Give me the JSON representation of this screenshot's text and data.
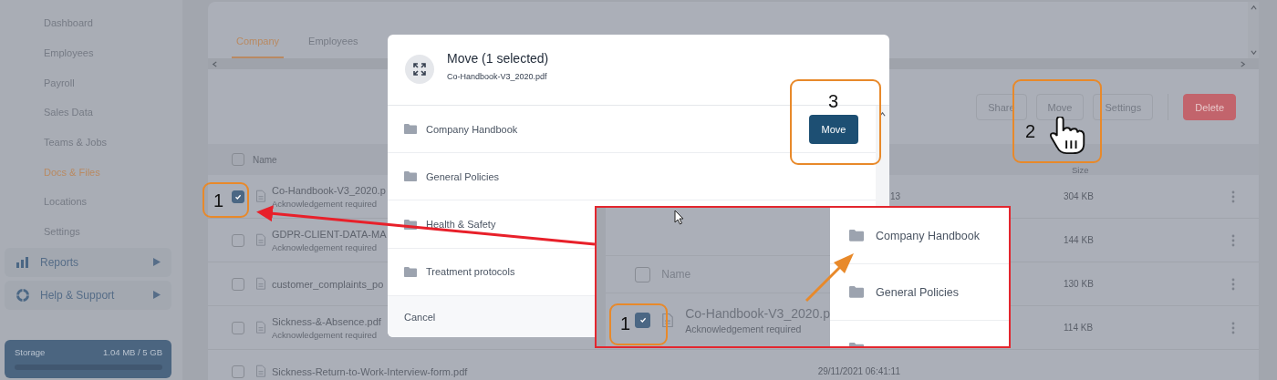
{
  "sidebar": {
    "items": [
      {
        "label": "Dashboard",
        "selected": false
      },
      {
        "label": "Employees",
        "selected": false
      },
      {
        "label": "Payroll",
        "selected": false
      },
      {
        "label": "Sales Data",
        "selected": false
      },
      {
        "label": "Teams & Jobs",
        "selected": false
      },
      {
        "label": "Docs & Files",
        "selected": true
      },
      {
        "label": "Locations",
        "selected": false
      },
      {
        "label": "Settings",
        "selected": false
      }
    ],
    "groups": [
      {
        "label": "Reports",
        "kind": "chart"
      },
      {
        "label": "Help & Support",
        "kind": "support"
      }
    ],
    "storage": {
      "label": "Storage",
      "reading": "1.04 MB / 5 GB",
      "level": 0.0002
    }
  },
  "tabs": [
    {
      "label": "Company",
      "selected": true
    },
    {
      "label": "Employees",
      "selected": false
    }
  ],
  "toolbar": [
    {
      "label": "Share",
      "kind": "outline"
    },
    {
      "label": "Move",
      "kind": "outline"
    },
    {
      "label": "Settings",
      "kind": "outline"
    },
    {
      "label": "Delete",
      "kind": "danger"
    }
  ],
  "table": {
    "columns": [
      "Name",
      "Size"
    ],
    "all_checked": false,
    "rows": [
      {
        "name": "Co-Handbook-V3_2020.p",
        "note": "Acknowledgement required",
        "date": "13",
        "size": "304 KB",
        "checked": true
      },
      {
        "name": "GDPR-CLIENT-DATA-MA",
        "note": "Acknowledgement required",
        "size": "144 KB",
        "checked": false
      },
      {
        "name": "customer_complaints_po",
        "size": "130 KB",
        "checked": false
      },
      {
        "name": "Sickness-&-Absence.pdf",
        "note": "Acknowledgement required",
        "size": "114 KB",
        "checked": false
      },
      {
        "name": "Sickness-Return-to-Work-Interview-form.pdf",
        "date": "29/11/2021 06:41:11",
        "checked": false
      }
    ]
  },
  "modal": {
    "title": "Move (1 selected)",
    "subtitle": "Co-Handbook-V3_2020.pdf",
    "confirm": "Move",
    "cancel": "Cancel",
    "folders": [
      "Company Handbook",
      "General Policies",
      "Health & Safety",
      "Treatment protocols"
    ]
  },
  "inset": {
    "column": "Name",
    "all_checked": false,
    "step": "1",
    "row": {
      "name": "Co-Handbook-V3_2020.p",
      "note": "Acknowledgement required",
      "checked": true
    },
    "folders": [
      "Company Handbook",
      "General Policies"
    ]
  },
  "callouts": [
    {
      "number": "1"
    },
    {
      "number": "2"
    },
    {
      "number": "3"
    }
  ]
}
